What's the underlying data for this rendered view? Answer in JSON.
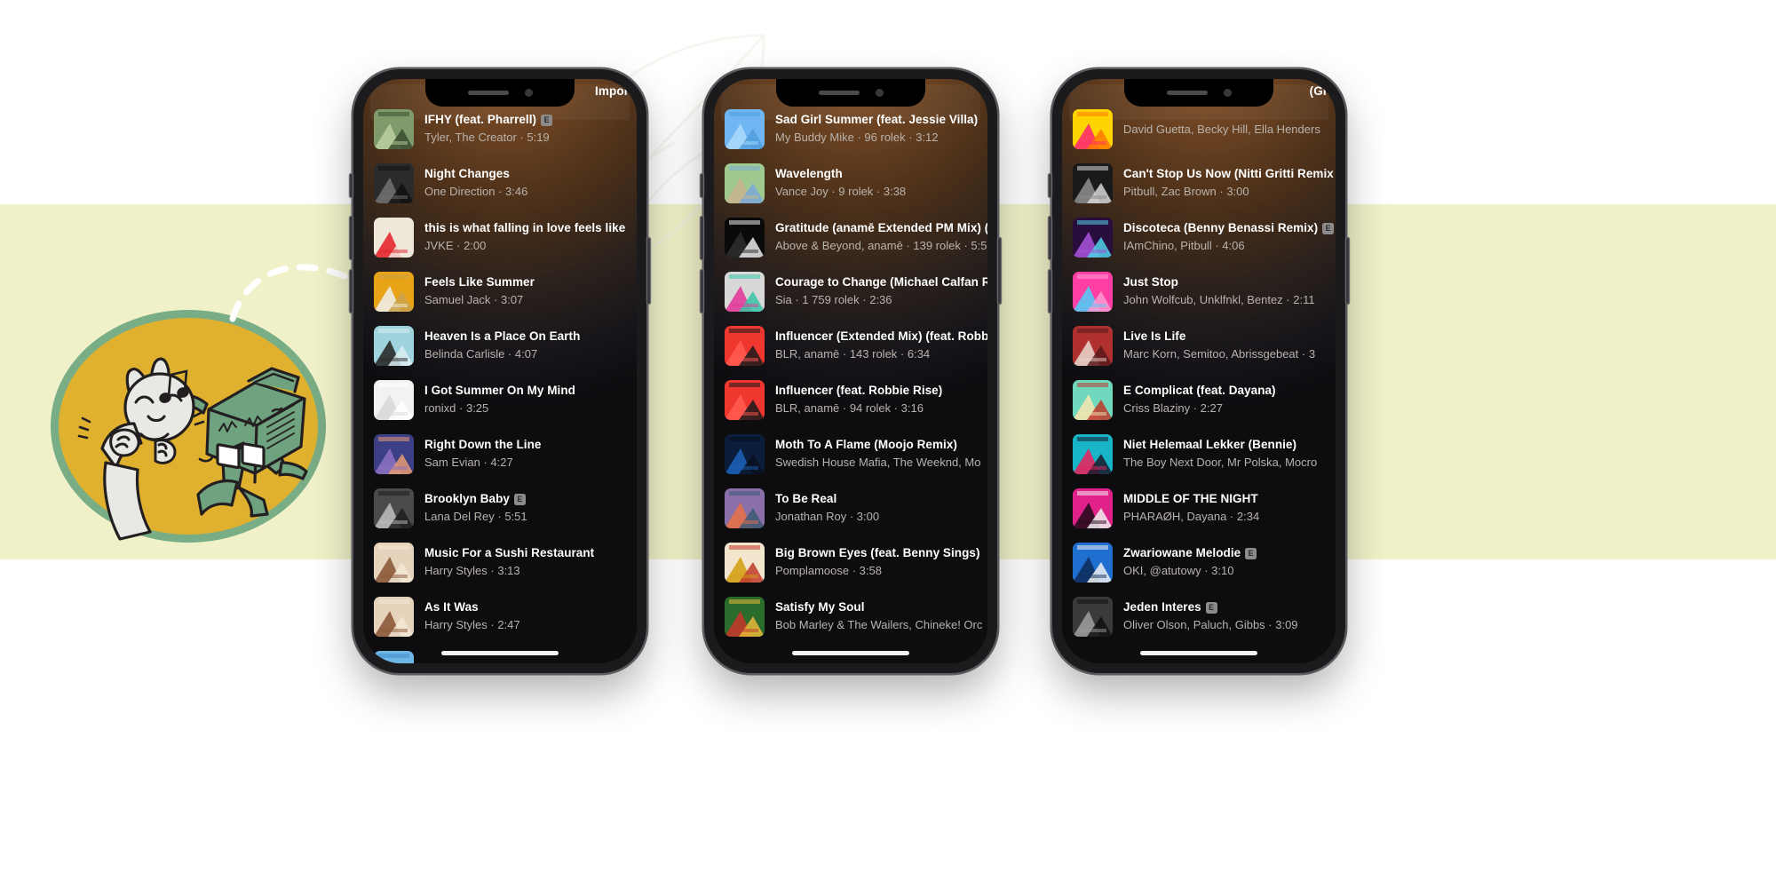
{
  "theme": {
    "band_color": "#f0f1c8",
    "page_background": "#ffffff",
    "screen_accent": "#8a5a2c",
    "title_color": "#ffffff",
    "subtitle_color": "#b9b3ad",
    "explicit_badge_label": "E",
    "mascot_disc_color": "#dfb12e",
    "mascot_ring_color": "#79ad86",
    "mascot_robot_color": "#6fa37f",
    "mascot_bunny_color": "#e8e8e5"
  },
  "icons": {
    "speaker": "speaker-grill-icon",
    "camera": "front-camera-icon",
    "home": "home-indicator-icon",
    "explicit": "explicit-badge-icon",
    "mascot": "bunny-and-boombox-robot-illustration",
    "swoosh": "dashed-arc-icon"
  },
  "phones": [
    {
      "id": "phone-left",
      "peek_title": "Importu",
      "peek_wide": false,
      "tracks": [
        {
          "title": "IFHY (feat. Pharrell)",
          "explicit": true,
          "subtitle": "Tyler, The Creator · 5:19",
          "art": "ifhy"
        },
        {
          "title": "Night Changes",
          "explicit": false,
          "subtitle": "One Direction · 3:46",
          "art": "night-changes"
        },
        {
          "title": "this is what falling in love feels like",
          "explicit": false,
          "subtitle": "JVKE · 2:00",
          "art": "jvke"
        },
        {
          "title": "Feels Like Summer",
          "explicit": false,
          "subtitle": "Samuel Jack · 3:07",
          "art": "samuel-jack"
        },
        {
          "title": "Heaven Is a Place On Earth",
          "explicit": false,
          "subtitle": "Belinda Carlisle · 4:07",
          "art": "belinda"
        },
        {
          "title": "I Got Summer On My Mind",
          "explicit": false,
          "subtitle": "ronixd · 3:25",
          "art": "ronixd"
        },
        {
          "title": "Right Down the Line",
          "explicit": false,
          "subtitle": "Sam Evian · 4:27",
          "art": "sam-evian"
        },
        {
          "title": "Brooklyn Baby",
          "explicit": true,
          "subtitle": "Lana Del Rey · 5:51",
          "art": "lana"
        },
        {
          "title": "Music For a Sushi Restaurant",
          "explicit": false,
          "subtitle": "Harry Styles · 3:13",
          "art": "harry"
        },
        {
          "title": "As It Was",
          "explicit": false,
          "subtitle": "Harry Styles · 2:47",
          "art": "harry"
        },
        {
          "title": "",
          "explicit": false,
          "subtitle": "",
          "art": "blue-sky"
        }
      ]
    },
    {
      "id": "phone-middle",
      "peek_title": "",
      "peek_wide": false,
      "tracks": [
        {
          "title": "Sad Girl Summer (feat. Jessie Villa)",
          "explicit": false,
          "subtitle": "My Buddy Mike · 96 rolek · 3:12",
          "art": "sad-girl"
        },
        {
          "title": "Wavelength",
          "explicit": false,
          "subtitle": "Vance Joy · 9 rolek · 3:38",
          "art": "vance-joy"
        },
        {
          "title": "Gratitude (anamē Extended PM Mix) (f",
          "explicit": false,
          "subtitle": "Above & Beyond, anamē · 139 rolek · 5:5",
          "art": "above-beyond"
        },
        {
          "title": "Courage to Change (Michael Calfan Re",
          "explicit": false,
          "subtitle": "Sia · 1 759 rolek · 2:36",
          "art": "sia"
        },
        {
          "title": "Influencer (Extended Mix) (feat. Robbi",
          "explicit": false,
          "subtitle": "BLR, anamē · 143 rolek · 6:34",
          "art": "blr"
        },
        {
          "title": "Influencer (feat. Robbie Rise)",
          "explicit": false,
          "subtitle": "BLR, anamē · 94 rolek · 3:16",
          "art": "blr"
        },
        {
          "title": "Moth To A Flame (Moojo Remix)",
          "explicit": false,
          "subtitle": "Swedish House Mafia, The Weeknd, Mo",
          "art": "moth"
        },
        {
          "title": "To Be Real",
          "explicit": false,
          "subtitle": "Jonathan Roy · 3:00",
          "art": "jonathan-roy"
        },
        {
          "title": "Big Brown Eyes (feat. Benny Sings)",
          "explicit": false,
          "subtitle": "Pomplamoose · 3:58",
          "art": "pomplamoose"
        },
        {
          "title": "Satisfy My Soul",
          "explicit": false,
          "subtitle": "Bob Marley & The Wailers, Chineke! Orc",
          "art": "marley"
        }
      ]
    },
    {
      "id": "phone-right",
      "peek_title": "(Grafix Ext",
      "peek_wide": true,
      "tracks": [
        {
          "title": "",
          "explicit": false,
          "subtitle": "David Guetta, Becky Hill, Ella Henders",
          "art": "crazy-love"
        },
        {
          "title": "Can't Stop Us Now (Nitti Gritti Remix",
          "explicit": false,
          "subtitle": "Pitbull, Zac Brown · 3:00",
          "art": "pitbull"
        },
        {
          "title": "Discoteca (Benny Benassi Remix)",
          "explicit": true,
          "subtitle": "IAmChino, Pitbull · 4:06",
          "art": "discoteca"
        },
        {
          "title": "Just Stop",
          "explicit": false,
          "subtitle": "John Wolfcub, Unklfnkl, Bentez · 2:11",
          "art": "just-stop"
        },
        {
          "title": "Live Is Life",
          "explicit": false,
          "subtitle": "Marc Korn, Semitoo, Abrissgebeat · 3",
          "art": "live-is-life"
        },
        {
          "title": "E Complicat (feat. Dayana)",
          "explicit": false,
          "subtitle": "Criss Blaziny · 2:27",
          "art": "e-complicat"
        },
        {
          "title": "Niet Helemaal Lekker (Bennie)",
          "explicit": false,
          "subtitle": "The Boy Next Door, Mr Polska, Mocro",
          "art": "niet-helemaal"
        },
        {
          "title": "MIDDLE OF THE NIGHT",
          "explicit": false,
          "subtitle": "PHARAØH, Dayana · 2:34",
          "art": "middle-night"
        },
        {
          "title": "Zwariowane Melodie",
          "explicit": true,
          "subtitle": "OKI, @atutowy · 3:10",
          "art": "oki"
        },
        {
          "title": "Jeden Interes",
          "explicit": true,
          "subtitle": "Oliver Olson, Paluch, Gibbs · 3:09",
          "art": "jeden-interes"
        }
      ]
    }
  ]
}
